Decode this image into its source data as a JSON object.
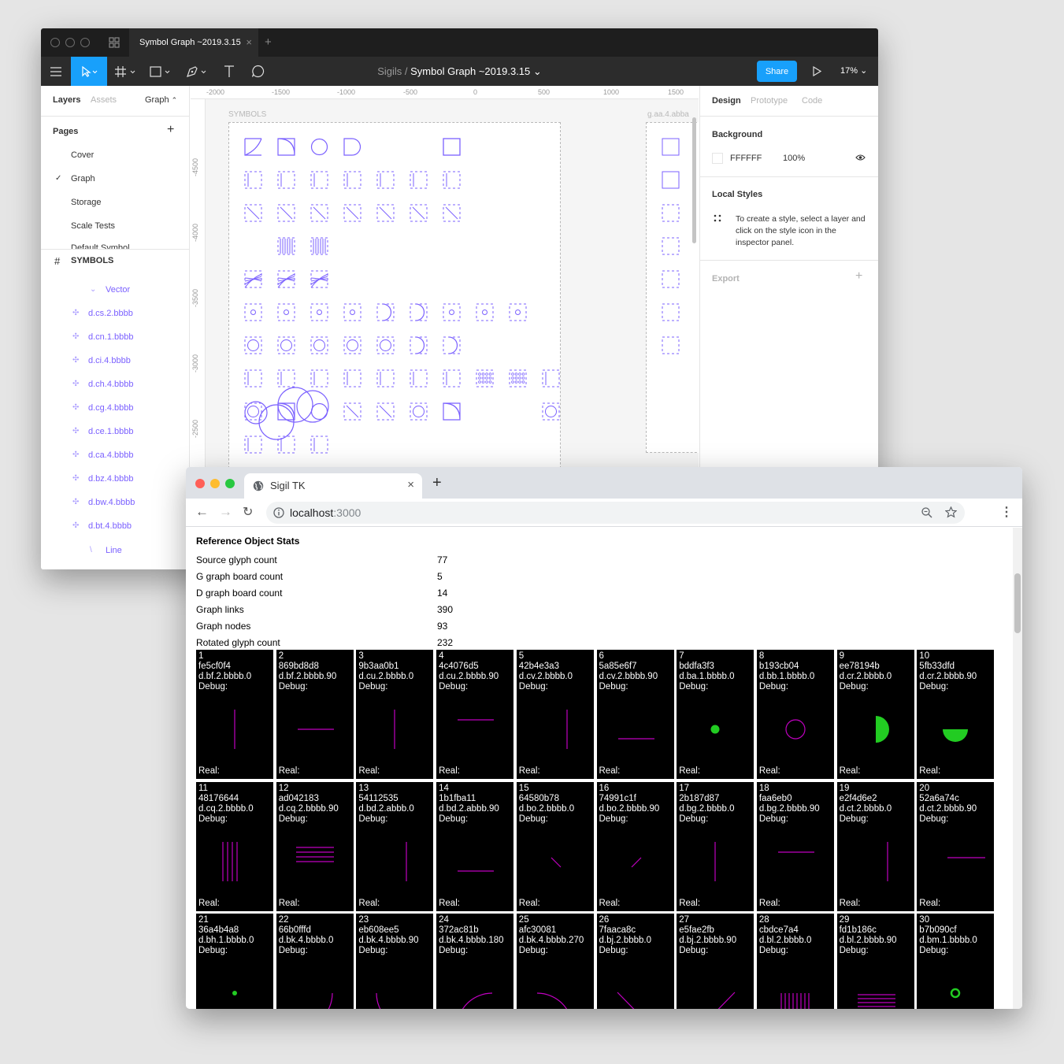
{
  "figma": {
    "tab_title": "Symbol Graph ~2019.3.15",
    "tab_close": "×",
    "new_tab": "+",
    "breadcrumb_parent": "Sigils",
    "breadcrumb_sep": "/",
    "file_title": "Symbol Graph ~2019.3.15",
    "share_label": "Share",
    "zoom_label": "17%",
    "left_tabs": {
      "layers": "Layers",
      "assets": "Assets",
      "page": "Graph"
    },
    "pages_header": "Pages",
    "pages": [
      "Cover",
      "Graph",
      "Storage",
      "Scale Tests",
      "Default Symbol"
    ],
    "symbols_header": "SYMBOLS",
    "layers": [
      "Vector",
      "d.cs.2.bbbb",
      "d.cn.1.bbbb",
      "d.ci.4.bbbb",
      "d.ch.4.bbbb",
      "d.cg.4.bbbb",
      "d.ce.1.bbbb",
      "d.ca.4.bbbb",
      "d.bz.4.bbbb",
      "d.bw.4.bbbb",
      "d.bt.4.bbbb",
      "Line"
    ],
    "ruler_top": [
      "-2000",
      "-1500",
      "-1000",
      "-500",
      "0",
      "500",
      "1000",
      "1500"
    ],
    "ruler_left": [
      "-4500",
      "-4000",
      "-3500",
      "-3000",
      "-2500"
    ],
    "board_label": "SYMBOLS",
    "board2_label": "g.aa.4.abba",
    "right_tabs": {
      "design": "Design",
      "prototype": "Prototype",
      "code": "Code"
    },
    "background_header": "Background",
    "background_hex": "FFFFFF",
    "background_opacity": "100%",
    "local_styles_header": "Local Styles",
    "local_styles_text": "To create a style, select a layer and click on the style icon in the inspector panel.",
    "export_header": "Export",
    "accent": "#18a0fb",
    "symbol_color": "#7b61ff"
  },
  "chrome": {
    "tab_title": "Sigil TK",
    "tab_close": "×",
    "new_tab": "+",
    "url_host": "localhost",
    "url_port": ":3000",
    "stats_title": "Reference Object Stats",
    "stats": [
      {
        "label": "Source glyph count",
        "value": "77"
      },
      {
        "label": "G graph board count",
        "value": "5"
      },
      {
        "label": "D graph board count",
        "value": "14"
      },
      {
        "label": "Graph links",
        "value": "390"
      },
      {
        "label": "Graph nodes",
        "value": "93"
      },
      {
        "label": "Rotated glyph count",
        "value": "232"
      }
    ],
    "debug_label": "Debug:",
    "real_label": "Real:",
    "cards": [
      {
        "n": "1",
        "hash": "fe5cf0f4",
        "name": "d.bf.2.bbbb.0",
        "glyph": "vline"
      },
      {
        "n": "2",
        "hash": "869bd8d8",
        "name": "d.bf.2.bbbb.90",
        "glyph": "hline"
      },
      {
        "n": "3",
        "hash": "9b3aa0b1",
        "name": "d.cu.2.bbbb.0",
        "glyph": "vline"
      },
      {
        "n": "4",
        "hash": "4c4076d5",
        "name": "d.cu.2.bbbb.90",
        "glyph": "hline-top"
      },
      {
        "n": "5",
        "hash": "42b4e3a3",
        "name": "d.cv.2.bbbb.0",
        "glyph": "vline-right"
      },
      {
        "n": "6",
        "hash": "5a85e6f7",
        "name": "d.cv.2.bbbb.90",
        "glyph": "hline-bottom"
      },
      {
        "n": "7",
        "hash": "bddfa3f3",
        "name": "d.ba.1.bbbb.0",
        "glyph": "dot"
      },
      {
        "n": "8",
        "hash": "b193cb04",
        "name": "d.bb.1.bbbb.0",
        "glyph": "circle"
      },
      {
        "n": "9",
        "hash": "ee78194b",
        "name": "d.cr.2.bbbb.0",
        "glyph": "half-right"
      },
      {
        "n": "10",
        "hash": "5fb33dfd",
        "name": "d.cr.2.bbbb.90",
        "glyph": "half-bottom"
      },
      {
        "n": "11",
        "hash": "48176644",
        "name": "d.cq.2.bbbb.0",
        "glyph": "vlines"
      },
      {
        "n": "12",
        "hash": "ad042183",
        "name": "d.cq.2.bbbb.90",
        "glyph": "hlines"
      },
      {
        "n": "13",
        "hash": "54112535",
        "name": "d.bd.2.abbb.0",
        "glyph": "vline-right"
      },
      {
        "n": "14",
        "hash": "1b1fba11",
        "name": "d.bd.2.abbb.90",
        "glyph": "hline-bottom"
      },
      {
        "n": "15",
        "hash": "64580b78",
        "name": "d.bo.2.bbbb.0",
        "glyph": "diag-short-down"
      },
      {
        "n": "16",
        "hash": "74991c1f",
        "name": "d.bo.2.bbbb.90",
        "glyph": "diag-short-up"
      },
      {
        "n": "17",
        "hash": "2b187d87",
        "name": "d.bg.2.bbbb.0",
        "glyph": "vline"
      },
      {
        "n": "18",
        "hash": "faa6eb0",
        "name": "d.bg.2.bbbb.90",
        "glyph": "hline-top"
      },
      {
        "n": "19",
        "hash": "e2f4d6e2",
        "name": "d.ct.2.bbbb.0",
        "glyph": "vline-right"
      },
      {
        "n": "20",
        "hash": "52a6a74c",
        "name": "d.ct.2.bbbb.90",
        "glyph": "hline-mid-right"
      },
      {
        "n": "21",
        "hash": "36a4b4a8",
        "name": "d.bh.1.bbbb.0",
        "glyph": "small-dot"
      },
      {
        "n": "22",
        "hash": "66b0fffd",
        "name": "d.bk.4.bbbb.0",
        "glyph": "arc-br"
      },
      {
        "n": "23",
        "hash": "eb608ee5",
        "name": "d.bk.4.bbbb.90",
        "glyph": "arc-bl"
      },
      {
        "n": "24",
        "hash": "372ac81b",
        "name": "d.bk.4.bbbb.180",
        "glyph": "arc-tl"
      },
      {
        "n": "25",
        "hash": "afc30081",
        "name": "d.bk.4.bbbb.270",
        "glyph": "arc-tr"
      },
      {
        "n": "26",
        "hash": "7faaca8c",
        "name": "d.bj.2.bbbb.0",
        "glyph": "diag-down"
      },
      {
        "n": "27",
        "hash": "e5fae2fb",
        "name": "d.bj.2.bbbb.90",
        "glyph": "diag-up"
      },
      {
        "n": "28",
        "hash": "cbdce7a4",
        "name": "d.bl.2.bbbb.0",
        "glyph": "vlines-bottom"
      },
      {
        "n": "29",
        "hash": "fd1b186c",
        "name": "d.bl.2.bbbb.90",
        "glyph": "hlines-bottom"
      },
      {
        "n": "30",
        "hash": "b7b090cf",
        "name": "d.bm.1.bbbb.0",
        "glyph": "ring"
      }
    ],
    "stroke_color": "#c000c0",
    "fill_color": "#22cc22"
  }
}
